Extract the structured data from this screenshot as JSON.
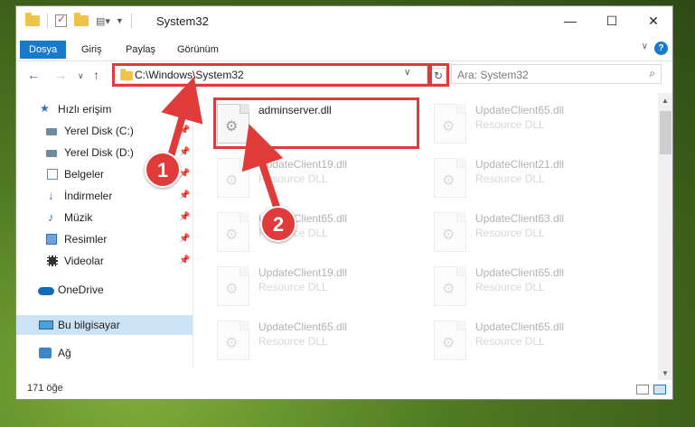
{
  "window": {
    "title": "System32",
    "minimize": "—",
    "maximize": "☐",
    "close": "✕"
  },
  "ribbon": {
    "tabs": [
      "Dosya",
      "Giriş",
      "Paylaş",
      "Görünüm"
    ]
  },
  "address": {
    "path": "C:\\Windows\\System32",
    "search_placeholder": "Ara: System32"
  },
  "nav": {
    "quick_access": "Hızlı erişim",
    "items": [
      {
        "label": "Yerel Disk (C:)",
        "pinned": true
      },
      {
        "label": "Yerel Disk (D:)",
        "pinned": true
      },
      {
        "label": "Belgeler",
        "pinned": true
      },
      {
        "label": "İndirmeler",
        "pinned": true
      },
      {
        "label": "Müzik",
        "pinned": true
      },
      {
        "label": "Resimler",
        "pinned": true
      },
      {
        "label": "Videolar",
        "pinned": true
      }
    ],
    "onedrive": "OneDrive",
    "this_pc": "Bu bilgisayar",
    "network": "Ağ"
  },
  "files": [
    {
      "name": "adminserver.dll",
      "type": ""
    },
    {
      "name": "UpdateClient65.dll",
      "type": "Resource DLL"
    },
    {
      "name": "UpdateClient19.dll",
      "type": "Resource DLL"
    },
    {
      "name": "UpdateClient21.dll",
      "type": "Resource DLL"
    },
    {
      "name": "UpdateClient65.dll",
      "type": "Resource DLL"
    },
    {
      "name": "UpdateClient63.dll",
      "type": "Resource DLL"
    },
    {
      "name": "UpdateClient19.dll",
      "type": "Resource DLL"
    },
    {
      "name": "UpdateClient65.dll",
      "type": "Resource DLL"
    },
    {
      "name": "UpdateClient65.dll",
      "type": "Resource DLL"
    },
    {
      "name": "UpdateClient65.dll",
      "type": "Resource DLL"
    }
  ],
  "status": {
    "item_count": "171 öğe"
  },
  "annotations": {
    "step1": "1",
    "step2": "2",
    "color": "#e03a3a"
  }
}
